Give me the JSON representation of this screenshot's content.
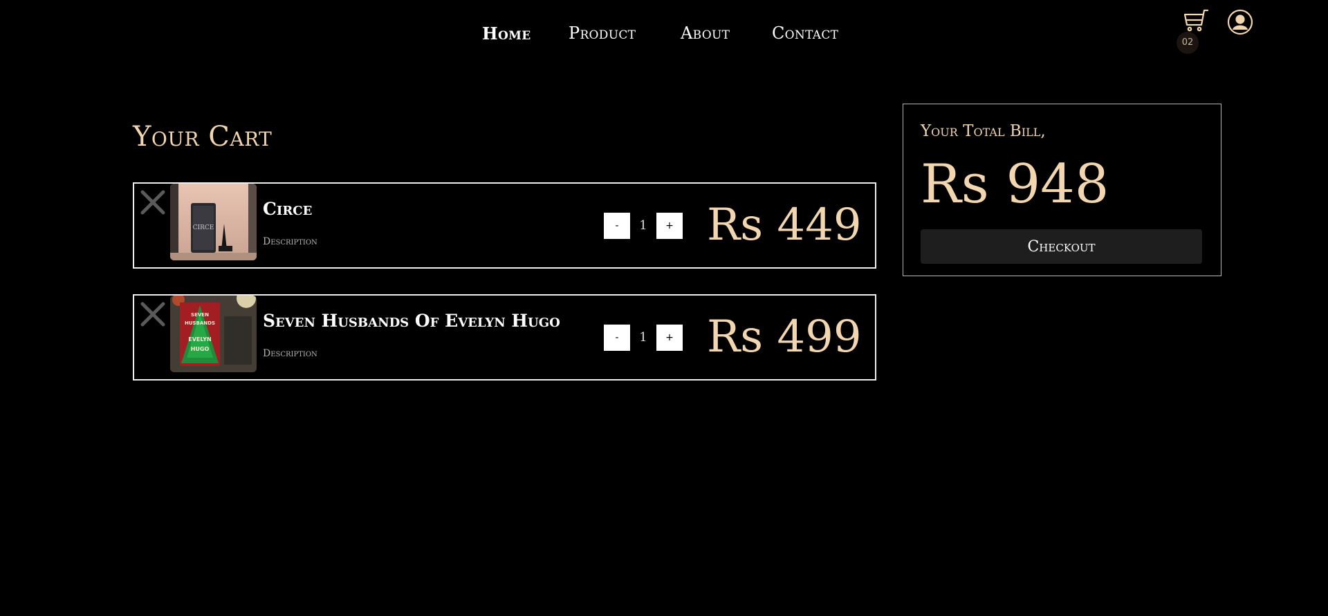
{
  "nav": {
    "links": [
      {
        "label": "Home",
        "active": true
      },
      {
        "label": "Product",
        "active": false
      },
      {
        "label": "About",
        "active": false
      },
      {
        "label": "Contact",
        "active": false
      }
    ],
    "cart_icon": "cart-icon",
    "cart_count": "02",
    "user_icon": "user-circle-icon"
  },
  "page": {
    "title": "Your Cart"
  },
  "cart": {
    "items": [
      {
        "name": "Circe",
        "description": "Description",
        "quantity": "1",
        "minus_label": "-",
        "plus_label": "+",
        "price": "Rs 449"
      },
      {
        "name": "Seven Husbands Of Evelyn Hugo",
        "description": "Description",
        "quantity": "1",
        "minus_label": "-",
        "plus_label": "+",
        "price": "Rs 499"
      }
    ]
  },
  "bill": {
    "label": "Your Total Bill,",
    "total": "Rs 948",
    "checkout_label": "Checkout"
  },
  "colors": {
    "background": "#000000",
    "accent": "#f1d6b0",
    "button_dark": "#1e1e1e"
  }
}
